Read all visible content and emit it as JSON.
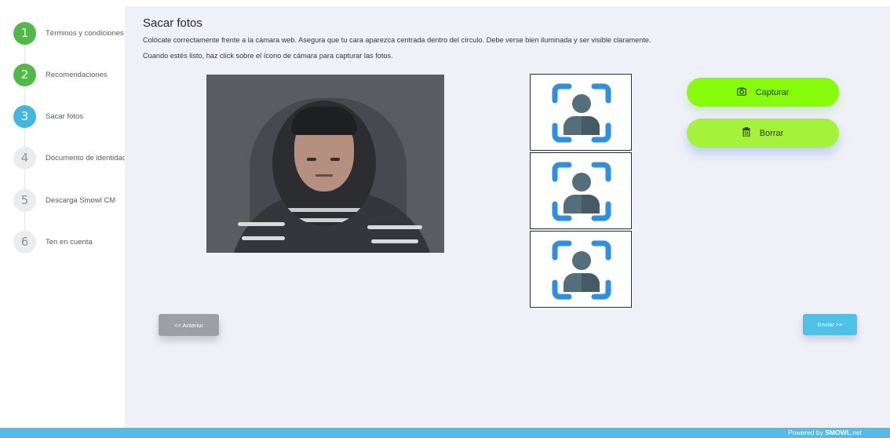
{
  "steps": [
    {
      "number": "1",
      "label": "Términos y condiciones",
      "status": "done"
    },
    {
      "number": "2",
      "label": "Recomendaciones",
      "status": "done"
    },
    {
      "number": "3",
      "label": "Sacar fotos",
      "status": "active"
    },
    {
      "number": "4",
      "label": "Documento de identidad",
      "status": "todo"
    },
    {
      "number": "5",
      "label": "Descarga Smowl CM",
      "status": "todo"
    },
    {
      "number": "6",
      "label": "Ten en cuenta",
      "status": "todo"
    }
  ],
  "main": {
    "title": "Sacar fotos",
    "description_line1": "Colócate correctamente frente a la cámara web. Asegura que tu cara aparezca centrada dentro del círculo. Debe verse bien iluminada y ser visible claramente.",
    "description_line2": "Cuando estés listo, haz click sobre el ícono de cámara para capturar las fotos."
  },
  "actions": {
    "capture_label": "Capturar",
    "capture_icon": "camera-icon",
    "delete_label": "Borrar",
    "delete_icon": "trash-icon"
  },
  "nav": {
    "prev_label": "<< Anterior",
    "next_label": "Enviar >>"
  },
  "footer": {
    "powered_prefix": "Powered by ",
    "brand": "SMOWL",
    "suffix": ".net"
  },
  "colors": {
    "step_done": "#52b948",
    "step_active": "#43b6e4",
    "capture_button": "#86fb0a",
    "delete_button": "#a4f23a",
    "footer": "#51bbe9",
    "placeholder_corner": "#2f8fe3"
  }
}
